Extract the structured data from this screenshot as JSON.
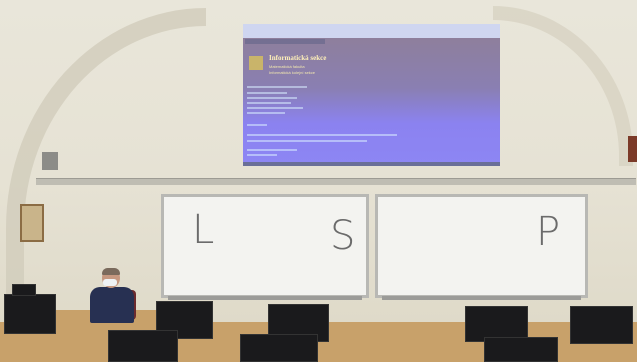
{
  "scene": {
    "description_note": "",
    "projection": {
      "title": "Informatická sekce",
      "subtitle_1": "Matematická fakulta",
      "subtitle_2": "Informatická kolejní sekce"
    },
    "whiteboard_left": {
      "letters": [
        "L",
        "S"
      ]
    },
    "whiteboard_right": {
      "letters": [
        "P"
      ]
    }
  },
  "colors": {
    "wall": "#e6e2d4",
    "projection": "#8b82f0",
    "desk": "#c8a16a",
    "whiteboard": "#f3f3f0"
  }
}
